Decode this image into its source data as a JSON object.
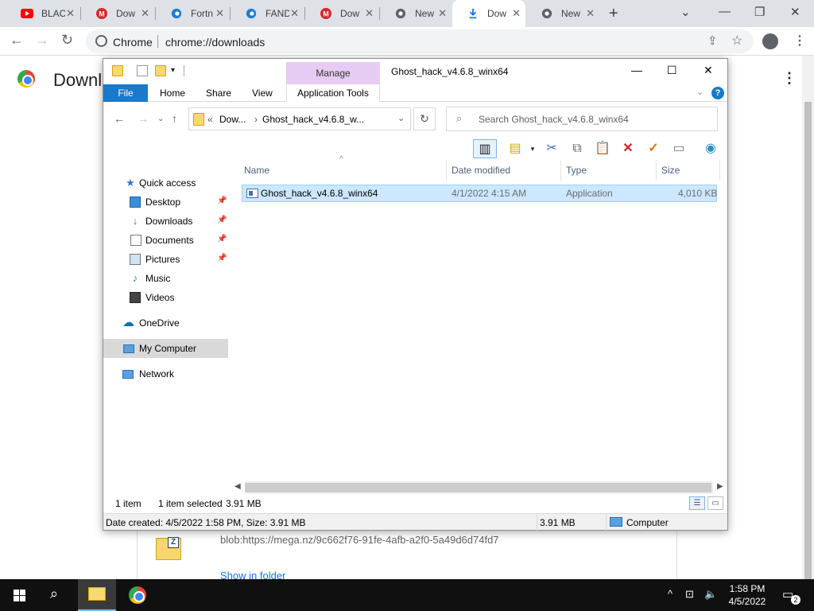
{
  "chrome": {
    "tabs": [
      {
        "label": "BLAC",
        "icon": "youtube-icon"
      },
      {
        "label": "Dow",
        "icon": "mega-icon"
      },
      {
        "label": "Fortn",
        "icon": "edge-icon"
      },
      {
        "label": "FAND",
        "icon": "edge-icon"
      },
      {
        "label": "Dow",
        "icon": "mega-icon"
      },
      {
        "label": "New",
        "icon": "chrome-icon"
      },
      {
        "label": "Dow",
        "icon": "download-icon"
      },
      {
        "label": "New",
        "icon": "chrome-icon"
      }
    ],
    "address_site": "Chrome",
    "address_url": "chrome://downloads",
    "page_title": "Downl",
    "download_url": "blob:https://mega.nz/9c662f76-91fe-4afb-a2f0-5a49d6d74fd7",
    "show_in_folder": "Show in folder"
  },
  "explorer": {
    "window_title": "Ghost_hack_v4.6.8_winx64",
    "manage_label": "Manage",
    "ribbon_tabs": [
      "File",
      "Home",
      "Share",
      "View"
    ],
    "app_tools_label": "Application Tools",
    "breadcrumb": [
      "Dow...",
      "Ghost_hack_v4.6.8_w..."
    ],
    "breadcrumb_prefix": "«",
    "search_placeholder": "Search Ghost_hack_v4.6.8_winx64",
    "nav": {
      "quick_access": "Quick access",
      "desktop": "Desktop",
      "downloads": "Downloads",
      "documents": "Documents",
      "pictures": "Pictures",
      "music": "Music",
      "videos": "Videos",
      "onedrive": "OneDrive",
      "my_computer": "My Computer",
      "network": "Network"
    },
    "columns": {
      "name": "Name",
      "date": "Date modified",
      "type": "Type",
      "size": "Size"
    },
    "files": [
      {
        "name": "Ghost_hack_v4.6.8_winx64",
        "date": "4/1/2022 4:15 AM",
        "type": "Application",
        "size": "4,010 KB"
      }
    ],
    "status": {
      "count": "1 item",
      "selected": "1 item selected",
      "selected_size": "3.91 MB"
    },
    "details": {
      "info": "Date created: 4/5/2022 1:58 PM, Size: 3.91 MB",
      "size": "3.91 MB",
      "location": "Computer"
    }
  },
  "taskbar": {
    "time": "1:58 PM",
    "date": "4/5/2022",
    "notifications": "2"
  },
  "colors": {
    "file_tab": "#1979ca",
    "manage_tab": "#e6ccf2",
    "selection": "#cce8ff",
    "taskbar": "#101010"
  }
}
